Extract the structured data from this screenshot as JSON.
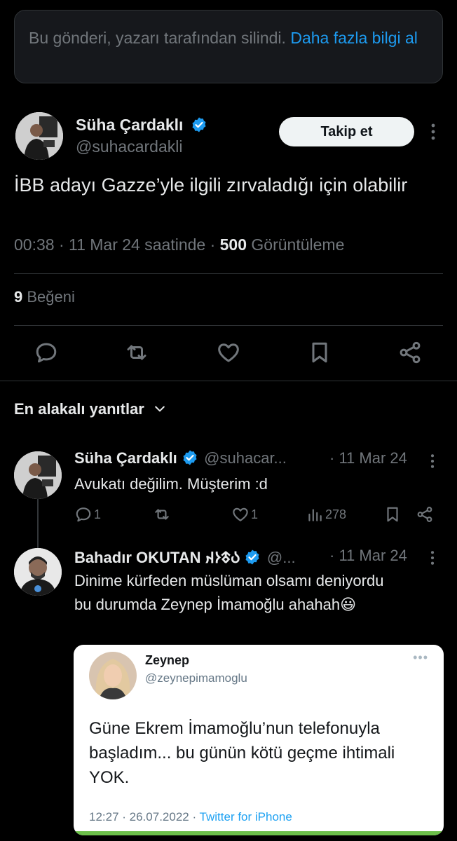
{
  "notice": {
    "text": "Bu gönderi, yazarı tarafından silindi. ",
    "link": "Daha fazla bilgi al"
  },
  "post": {
    "author_name": "Süha Çardaklı",
    "author_handle": "@suhacardakli",
    "follow_label": "Takip et",
    "text": "İBB adayı Gazze’yle ilgili zırvaladığı için olabilir",
    "time": "00:38 · 11 Mar 24 saatinde · ",
    "views_count": "500",
    "views_label": " Görüntüleme",
    "likes_count": "9",
    "likes_label": " Beğeni"
  },
  "replies_header": "En alakalı yanıtlar",
  "replies": [
    {
      "author_name": "Süha Çardaklı",
      "author_handle": "@suhacar...",
      "date": "· 11 Mar 24",
      "text": "Avukatı değilim. Müşterim :d",
      "reply_count": "1",
      "like_count": "1",
      "view_count": "278"
    },
    {
      "author_name": "Bahadır OKUTAN 𐰉𐱃𐰆𐰴",
      "author_handle": "@...",
      "date": "· 11 Mar 24",
      "text": "Dinime kürfeden müslüman olsamı deniyordu bu durumda Zeynep İmamoğlu ahahah😃",
      "embed": {
        "name": "Zeynep",
        "handle": "@zeynepimamoglu",
        "dots": "•••",
        "text": "Güne Ekrem İmamoğlu’nun telefonuyla başladım... bu günün kötü geçme ihtimali YOK.",
        "time": "12:27 · 26.07.2022 · ",
        "source": "Twitter for iPhone"
      }
    }
  ],
  "colors": {
    "background": "#000000",
    "accent": "#1d9bf0",
    "muted": "#71767b",
    "text": "#e7e9ea"
  },
  "icons": [
    "verified-badge-icon",
    "more-icon",
    "reply-icon",
    "retweet-icon",
    "like-icon",
    "bookmark-icon",
    "share-icon",
    "views-icon",
    "chevron-down-icon"
  ]
}
